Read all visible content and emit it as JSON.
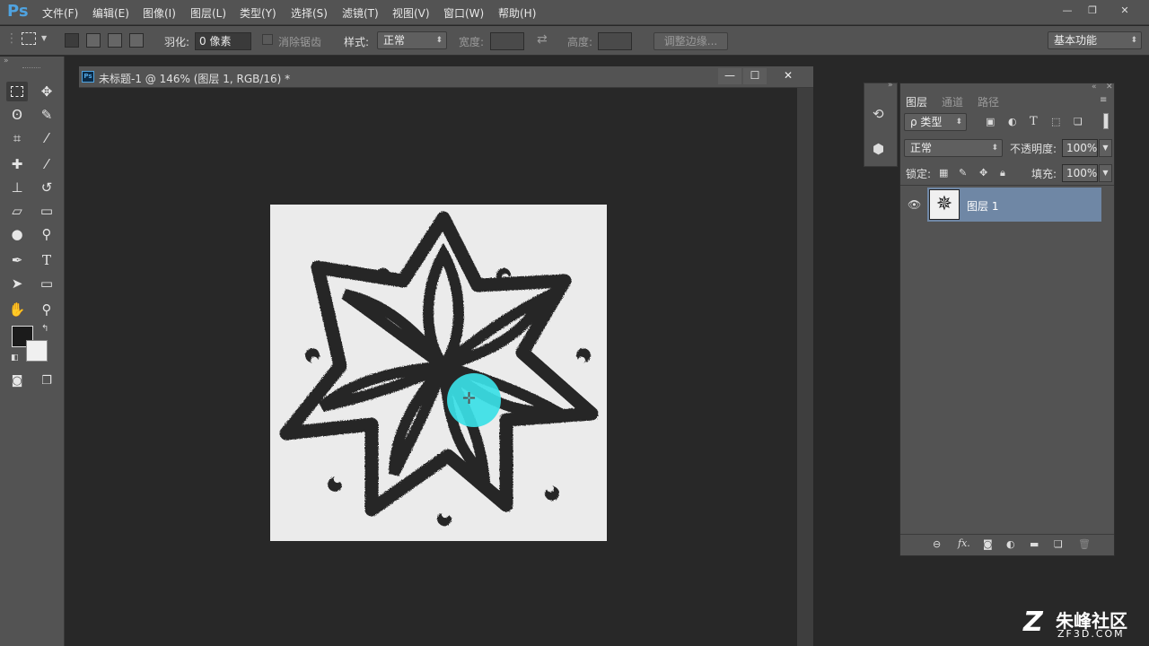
{
  "app": {
    "logo": "Ps",
    "menu": [
      "文件(F)",
      "编辑(E)",
      "图像(I)",
      "图层(L)",
      "类型(Y)",
      "选择(S)",
      "滤镜(T)",
      "视图(V)",
      "窗口(W)",
      "帮助(H)"
    ],
    "window_controls": [
      "—",
      "❐",
      "✕"
    ]
  },
  "options": {
    "feather_label": "羽化:",
    "feather_value": "0 像素",
    "antialias_label": "消除锯齿",
    "style_label": "样式:",
    "style_value": "正常",
    "width_label": "宽度:",
    "height_label": "高度:",
    "refine_edge": "调整边缘...",
    "workspace": "基本功能"
  },
  "document": {
    "title": "未标题-1 @ 146% (图层 1, RGB/16) *",
    "window_controls": [
      "—",
      "☐",
      "✕"
    ]
  },
  "layers": {
    "tabs": [
      "图层",
      "通道",
      "路径"
    ],
    "filter_kind": "ρ 类型",
    "blend_mode": "正常",
    "opacity_label": "不透明度:",
    "opacity_value": "100%",
    "lock_label": "锁定:",
    "fill_label": "填充:",
    "fill_value": "100%",
    "layer_name": "图层 1",
    "footer_icons": [
      "link-icon",
      "fx-icon",
      "mask-icon",
      "adjustment-icon",
      "folder-icon",
      "new-layer-icon",
      "trash-icon"
    ],
    "fx_label": "fx."
  },
  "watermark": {
    "brand": "朱峰社区",
    "url": "ZF3D.COM"
  },
  "colors": {
    "brush_cursor": "#39e0e6",
    "layer_selected": "#6f87a5",
    "panel_bg": "#535353"
  }
}
